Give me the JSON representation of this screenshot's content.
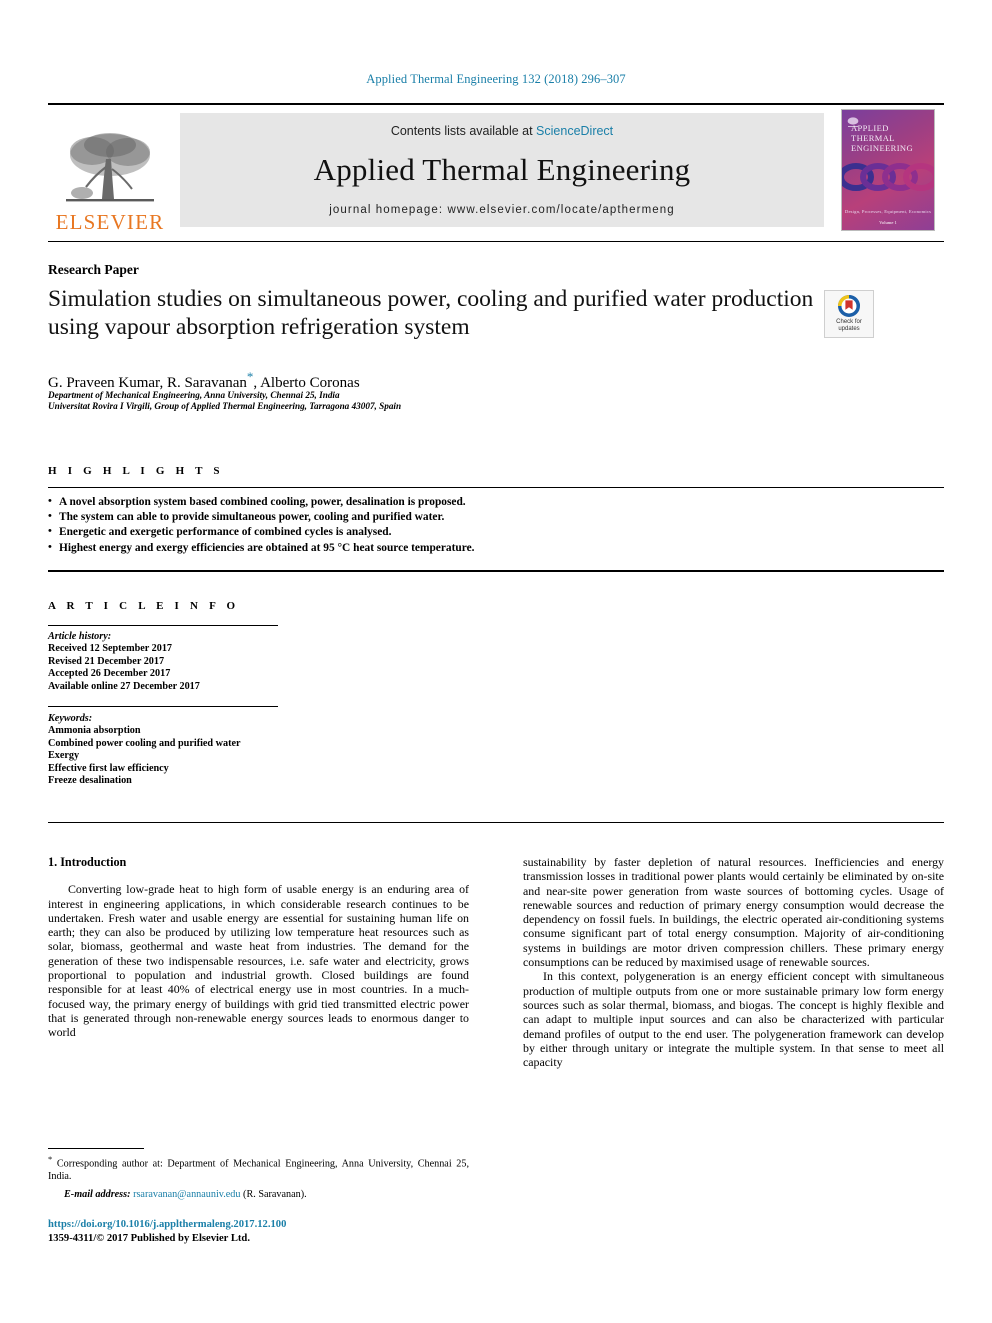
{
  "running_head": "Applied Thermal Engineering 132 (2018) 296–307",
  "masthead": {
    "publisher_logo_text": "ELSEVIER",
    "contents_prefix": "Contents lists available at ",
    "contents_link": "ScienceDirect",
    "journal_title": "Applied Thermal Engineering",
    "homepage": "journal homepage: www.elsevier.com/locate/apthermeng",
    "cover": {
      "line1": "APPLIED",
      "line2": "THERMAL",
      "line3": "ENGINEERING",
      "footer": "Design, Processes, Equipment, Economics",
      "volume": "Volume 1"
    }
  },
  "article": {
    "section_type": "Research Paper",
    "title": "Simulation studies on simultaneous power, cooling and purified water production using vapour absorption refrigeration system",
    "authors_pre": "G. Praveen Kumar, R. Saravanan",
    "authors_star": "*",
    "authors_post": ", Alberto Coronas",
    "affiliation_a": "Department of Mechanical Engineering, Anna University, Chennai 25, India",
    "affiliation_b": "Universitat Rovira I Virgili, Group of Applied Thermal Engineering, Tarragona 43007, Spain",
    "crossmark_line1": "Check for",
    "crossmark_line2": "updates"
  },
  "highlights": {
    "heading": "H I G H L I G H T S",
    "items": [
      "A novel absorption system based combined cooling, power, desalination is proposed.",
      "The system can able to provide simultaneous power, cooling and purified water.",
      "Energetic and exergetic performance of combined cycles is analysed.",
      "Highest energy and exergy efficiencies are obtained at 95 °C heat source temperature."
    ]
  },
  "article_info": {
    "heading": "A R T I C L E   I N F O",
    "history_label": "Article history:",
    "history": [
      "Received 12 September 2017",
      "Revised 21 December 2017",
      "Accepted 26 December 2017",
      "Available online 27 December 2017"
    ],
    "keywords_label": "Keywords:",
    "keywords": [
      "Ammonia absorption",
      "Combined power cooling and purified water",
      "Exergy",
      "Effective first law efficiency",
      "Freeze desalination"
    ]
  },
  "body": {
    "section_number_title": "1. Introduction",
    "left_paragraph_1": "Converting low-grade heat to high form of usable energy is an enduring area of interest in engineering applications, in which considerable research continues to be undertaken. Fresh water and usable energy are essential for sustaining human life on earth; they can also be produced by utilizing low temperature heat resources such as solar, biomass, geothermal and waste heat from industries. The demand for the generation of these two indispensable resources, i.e. safe water and electricity, grows proportional to population and industrial growth. Closed buildings are found responsible for at least 40% of electrical energy use in most countries. In a much-focused way, the primary energy of buildings with grid tied transmitted electric power that is generated through non-renewable energy sources leads to enormous danger to world",
    "right_paragraph_1": "sustainability by faster depletion of natural resources. Inefficiencies and energy transmission losses in traditional power plants would certainly be eliminated by on-site and near-site power generation from waste sources of bottoming cycles. Usage of renewable sources and reduction of primary energy consumption would decrease the dependency on fossil fuels. In buildings, the electric operated air-conditioning systems consume significant part of total energy consumption. Majority of air-conditioning systems in buildings are motor driven compression chillers. These primary energy consumptions can be reduced by maximised usage of renewable sources.",
    "right_paragraph_2": "In this context, polygeneration is an energy efficient concept with simultaneous production of multiple outputs from one or more sustainable primary low form energy sources such as solar thermal, biomass, and biogas. The concept is highly flexible and can adapt to multiple input sources and can also be characterized with particular demand profiles of output to the end user. The polygeneration framework can develop by either through unitary or integrate the multiple system. In that sense to meet all capacity"
  },
  "footnote": {
    "star": "*",
    "corresponding": " Corresponding author at: Department of Mechanical Engineering, Anna University, Chennai 25, India.",
    "email_label": "E-mail address:",
    "email": "rsaravanan@annauniv.edu",
    "email_owner": "(R. Saravanan).",
    "doi": "https://doi.org/10.1016/j.applthermaleng.2017.12.100",
    "copyright": "1359-4311/© 2017 Published by Elsevier Ltd."
  },
  "colors": {
    "link": "#1a7fa8",
    "elsevier_orange": "#e87722",
    "band_gray": "#e6e6e6"
  }
}
